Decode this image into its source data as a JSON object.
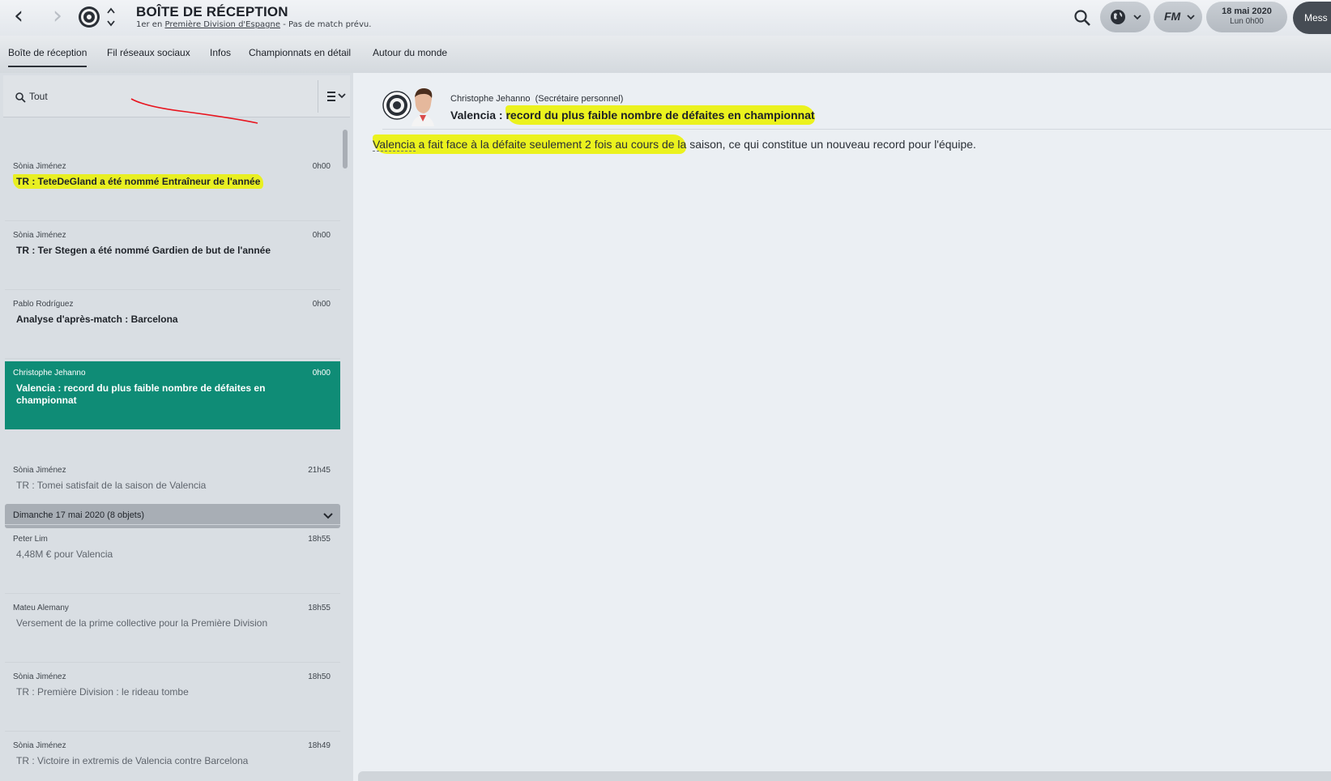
{
  "header": {
    "title": "BOÎTE DE RÉCEPTION",
    "subtitle_prefix": "1er en ",
    "subtitle_link": "Première Division d'Espagne",
    "subtitle_suffix": " - Pas de match prévu.",
    "date_line1": "18 mai 2020",
    "date_line2": "Lun 0h00",
    "mess_label": "Mess",
    "fm_label": "FM"
  },
  "tabs": [
    {
      "label": "Boîte de réception",
      "active": true
    },
    {
      "label": "Fil réseaux sociaux",
      "active": false
    },
    {
      "label": "Infos",
      "active": false
    },
    {
      "label": "Championnats en détail",
      "active": false
    },
    {
      "label": "Autour du monde",
      "active": false
    }
  ],
  "filter": {
    "label": "Tout"
  },
  "inbox": {
    "items": [
      {
        "sender": "Sònia Jiménez",
        "time": "0h00",
        "subject": "TR : TeteDeGland a été nommé Entraîneur de l'année"
      },
      {
        "sender": "Sònia Jiménez",
        "time": "0h00",
        "subject": "TR : Ter Stegen a été nommé Gardien de but de l'année"
      },
      {
        "sender": "Pablo Rodríguez",
        "time": "0h00",
        "subject": "Analyse d'après-match : Barcelona"
      },
      {
        "sender": "Christophe Jehanno",
        "time": "0h00",
        "subject": "Valencia : record du plus faible nombre de défaites en championnat"
      }
    ],
    "group_label": "Dimanche 17 mai 2020 (8 objets)",
    "group_items": [
      {
        "sender": "Sònia Jiménez",
        "time": "21h45",
        "subject": "TR : Tomei satisfait de la saison de Valencia"
      },
      {
        "sender": "Peter Lim",
        "time": "18h55",
        "subject": "4,48M € pour Valencia"
      },
      {
        "sender": "Mateu Alemany",
        "time": "18h55",
        "subject": "Versement de la prime collective pour la Première Division"
      },
      {
        "sender": "Sònia Jiménez",
        "time": "18h50",
        "subject": "TR : Première Division : le rideau tombe"
      },
      {
        "sender": "Sònia Jiménez",
        "time": "18h49",
        "subject": "TR : Victoire in extremis de Valencia contre Barcelona"
      }
    ]
  },
  "message": {
    "from_name": "Christophe Jehanno",
    "from_role": "(Secrétaire personnel)",
    "subject_prefix": "Valencia : ",
    "subject_rest": "record du plus faible nombre de défaites en championnat",
    "body_club": "Valencia",
    "body_part1": " a fait face à la défaite seulement 2 fois au cours de la",
    "body_part2": " saison, ce qui constitue un nouveau record pour l'équipe."
  },
  "colors": {
    "selected": "#0f8c76",
    "highlight": "#ebf200",
    "annotation_line": "#e8141e"
  }
}
